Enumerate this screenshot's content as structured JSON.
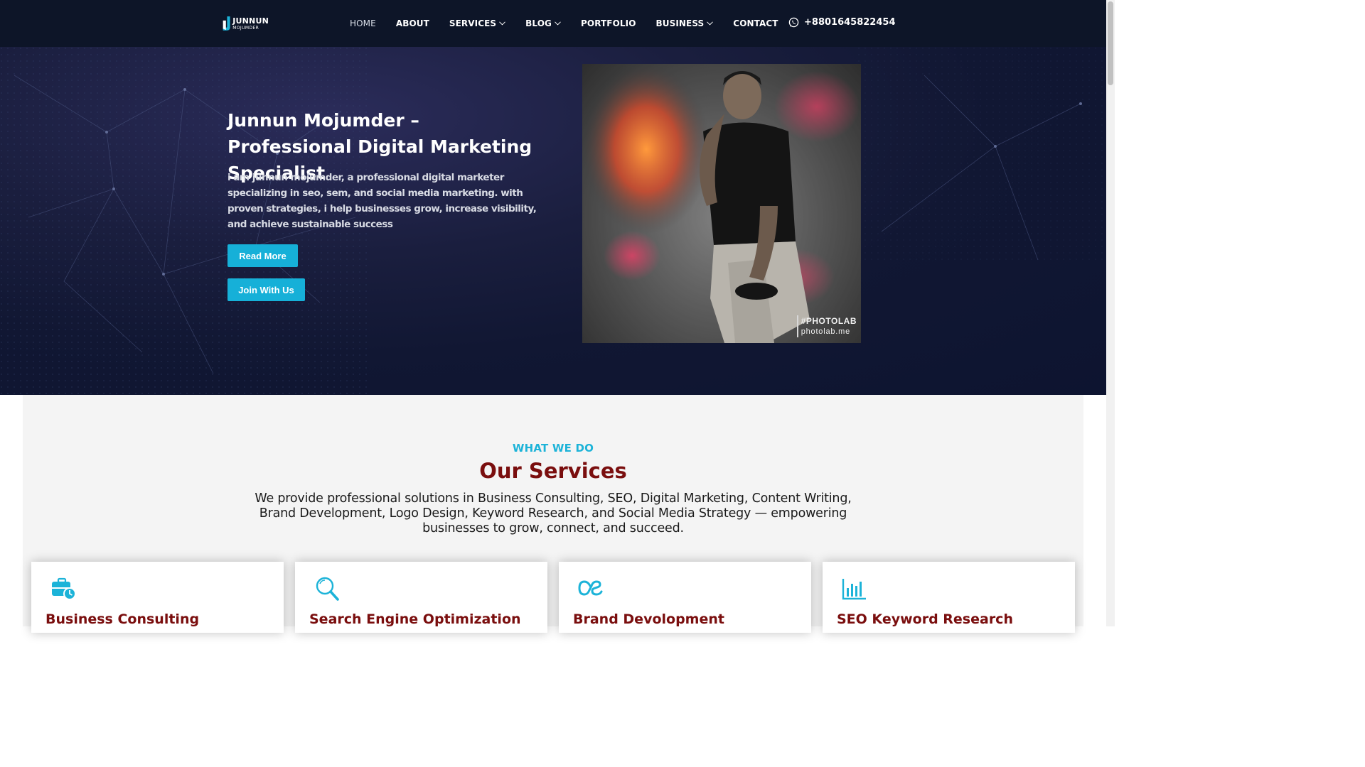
{
  "header": {
    "logo": {
      "line1": "JUNNUN",
      "line2": "MOJUMDER"
    },
    "nav": [
      {
        "label": "HOME",
        "dropdown": false,
        "active": true
      },
      {
        "label": "ABOUT",
        "dropdown": false
      },
      {
        "label": "SERVICES",
        "dropdown": true
      },
      {
        "label": "BLOG",
        "dropdown": true
      },
      {
        "label": "PORTFOLIO",
        "dropdown": false
      },
      {
        "label": "BUSINESS",
        "dropdown": true
      },
      {
        "label": "CONTACT",
        "dropdown": false
      }
    ],
    "phone": "+8801645822454",
    "phone_icon": "whatsapp-icon"
  },
  "hero": {
    "title": "Junnun Mojumder – Professional Digital Marketing Specialist",
    "description": "i am junnun mojumder, a professional digital marketer specializing in seo, sem, and social media marketing. with proven strategies, i help businesses grow, increase visibility, and achieve sustainable success",
    "buttons": {
      "read_more": "Read More",
      "join": "Join With Us"
    },
    "image_watermark": {
      "line1": "#PHOTOLAB",
      "line2": "photolab.me"
    }
  },
  "services": {
    "eyebrow": "WHAT WE DO",
    "title": "Our Services",
    "description": "We provide professional solutions in Business Consulting, SEO, Digital Marketing, Content Writing, Brand Development, Logo Design, Keyword Research, and Social Media Strategy — empowering businesses to grow, connect, and succeed.",
    "cards": [
      {
        "title": "Business Consulting",
        "icon": "briefcase-clock-icon"
      },
      {
        "title": "Search Engine Optimization",
        "icon": "magnifier-icon"
      },
      {
        "title": "Brand Devolopment",
        "icon": "lastfm-icon"
      },
      {
        "title": "SEO Keyword Research",
        "icon": "bar-chart-icon"
      }
    ]
  },
  "colors": {
    "header_bg": "#0d1528",
    "accent": "#16b0d8",
    "heading_red": "#7a0e0e",
    "section_bg": "#f4f4f4"
  }
}
